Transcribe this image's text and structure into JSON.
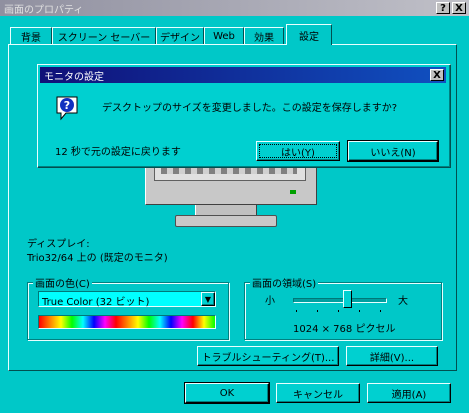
{
  "window": {
    "title": "画面のプロパティ",
    "help_btn": "?",
    "close_btn": "X"
  },
  "tabs": [
    {
      "label": "背景"
    },
    {
      "label": "スクリーン セーバー"
    },
    {
      "label": "デザイン"
    },
    {
      "label": "Web"
    },
    {
      "label": "効果"
    },
    {
      "label": "設定"
    }
  ],
  "dialog": {
    "title": "モニタの設定",
    "close_btn": "X",
    "message": "デスクトップのサイズを変更しました。この設定を保存しますか?",
    "countdown": "12 秒で元の設定に戻ります",
    "yes_label": "はい(Y)",
    "no_label": "いいえ(N)"
  },
  "display": {
    "label": "ディスプレイ:",
    "value": "Trio32/64 上の (既定のモニタ)"
  },
  "colors": {
    "group_label": "画面の色(C)",
    "selected": "True Color (32 ビット)",
    "palette": [
      "#ff0000",
      "#ff8000",
      "#ffff00",
      "#00ff00",
      "#00ffff",
      "#0000ff",
      "#ff00ff"
    ]
  },
  "area": {
    "group_label": "画面の領域(S)",
    "min_label": "小",
    "max_label": "大",
    "resolution": "1024 × 768 ピクセル",
    "slider_fraction": 0.6
  },
  "buttons": {
    "troubleshoot": "トラブルシューティング(T)...",
    "advanced": "詳細(V)...",
    "ok": "OK",
    "cancel": "キャンセル",
    "apply": "適用(A)"
  }
}
